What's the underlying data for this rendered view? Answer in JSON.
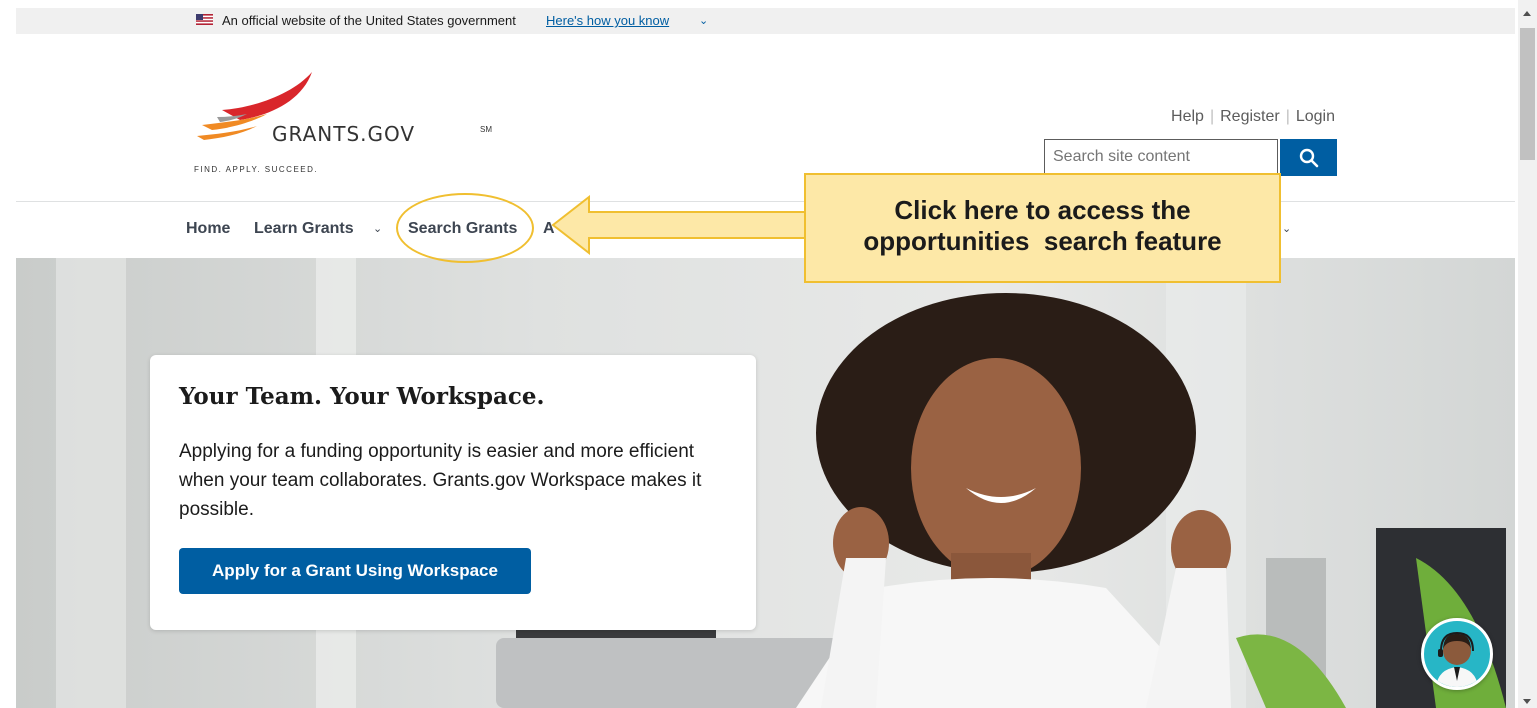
{
  "gov_banner": {
    "text": "An official website of the United States government",
    "link": "Here's how you know"
  },
  "logo": {
    "name": "GRANTS.GOV",
    "sm": "SM",
    "tagline": "FIND. APPLY. SUCCEED."
  },
  "utility_links": [
    "Help",
    "Register",
    "Login"
  ],
  "search": {
    "placeholder": "Search site content"
  },
  "nav": {
    "home": "Home",
    "learn_grants": "Learn Grants",
    "search_grants": "Search Grants",
    "applicants_partial": "A"
  },
  "callout": {
    "line1": "Click here to access the",
    "line2": "opportunities  search feature"
  },
  "hero": {
    "title": "Your Team. Your Workspace.",
    "body": "Applying for a funding opportunity is easier and more efficient when your team collaborates. Grants.gov Workspace makes it possible.",
    "button": "Apply for a Grant Using Workspace"
  },
  "colors": {
    "primary": "#005ea2",
    "callout_fill": "#fde8a7",
    "callout_border": "#f0bf30"
  }
}
